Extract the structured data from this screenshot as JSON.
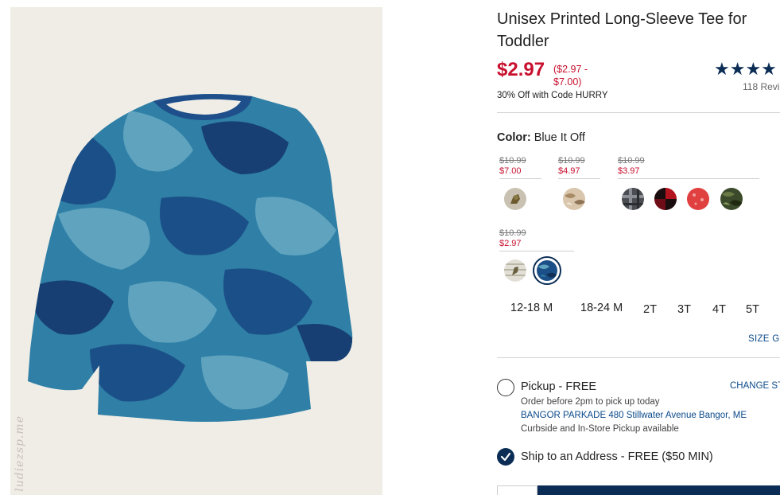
{
  "product": {
    "title": "Unisex Printed Long-Sleeve Tee for Toddler",
    "price": "$2.97",
    "price_range": "($2.97 - $7.00)",
    "promo": "30% Off with Code HURRY",
    "rating_stars": "★★★★",
    "reviews": "118 Revi"
  },
  "color": {
    "label": "Color:",
    "value": "Blue It Off",
    "groups": [
      {
        "old": "$10.99",
        "new": "$7.00"
      },
      {
        "old": "$10.99",
        "new": "$4.97"
      },
      {
        "old": "$10.99",
        "new": "$3.97"
      },
      {
        "old": "$10.99",
        "new": "$2.97"
      }
    ],
    "swatches": [
      {
        "name": "dinosaur-print"
      },
      {
        "name": "tan-camo"
      },
      {
        "name": "gray-plaid"
      },
      {
        "name": "red-buffalo-plaid"
      },
      {
        "name": "red-print"
      },
      {
        "name": "green-camo"
      },
      {
        "name": "striped-print"
      },
      {
        "name": "blue-camo",
        "selected": true
      }
    ]
  },
  "sizes": [
    "12-18 M",
    "18-24 M",
    "2T",
    "3T",
    "4T",
    "5T"
  ],
  "size_guide": "SIZE GU",
  "fulfillment": {
    "pickup_label": "Pickup - FREE",
    "pickup_note": "Order before 2pm to pick up today",
    "store": "BANGOR PARKADE 480 Stillwater Avenue  Bangor, ME",
    "curbside": "Curbside and In-Store Pickup available",
    "change_store": "CHANGE STO",
    "ship_label": "Ship to an Address - FREE ($50 MIN)"
  },
  "watermark": "ludiezsp.me",
  "colors": {
    "accent": "#0b2d55",
    "sale": "#c8102e",
    "link": "#0b4a8a"
  }
}
